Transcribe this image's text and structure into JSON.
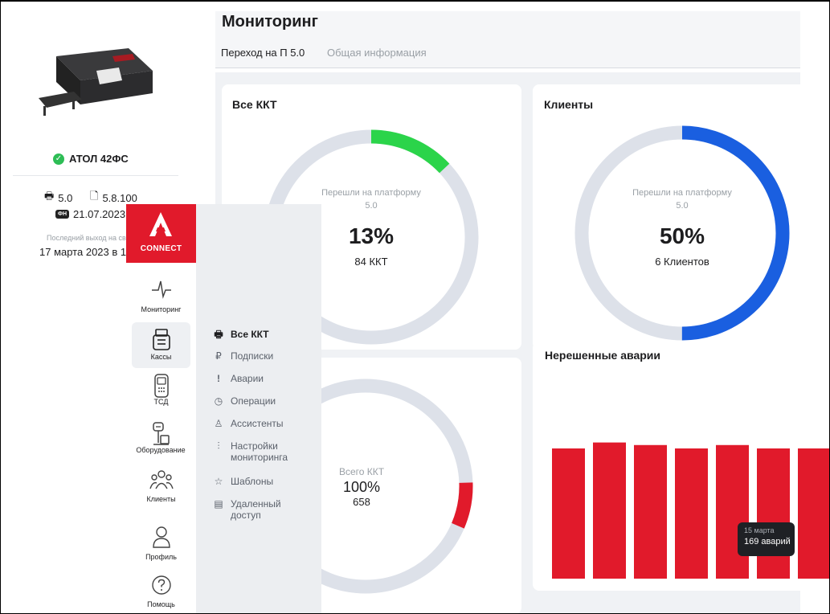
{
  "device": {
    "name": "АТОЛ 42ФС",
    "version_platform": "5.0",
    "version_firmware": "5.8.100",
    "fn_label": "ФН",
    "fn_date": "21.07.2023",
    "last_exit_label": "Последний выход на св",
    "last_exit_date": "17 марта 2023 в 1"
  },
  "header": {
    "title": "Мониторинг",
    "tabs": [
      {
        "label": "Переход на П 5.0",
        "active": true
      },
      {
        "label": "Общая информация",
        "active": false
      }
    ]
  },
  "cards": {
    "all_kkt": {
      "title": "Все ККТ",
      "sub": "Перешли на платформу 5.0",
      "percent": "13%",
      "count": "84 ККТ",
      "color": "#2bd44a"
    },
    "clients": {
      "title": "Клиенты",
      "sub": "Перешли на платформу 5.0",
      "percent": "50%",
      "count": "6 Клиентов",
      "color": "#1a5fe0"
    },
    "total": {
      "label": "Всего ККТ",
      "percent": "100%",
      "count": "658",
      "color": "#e11a2b"
    },
    "alarms": {
      "title": "Нерешенные аварии",
      "tooltip_date": "15 марта",
      "tooltip_value": "169 аварий",
      "color": "#e11a2b"
    }
  },
  "chart_data": [
    {
      "type": "pie",
      "name": "Все ККТ",
      "values": [
        13,
        87
      ]
    },
    {
      "type": "pie",
      "name": "Клиенты",
      "values": [
        50,
        50
      ]
    },
    {
      "type": "pie",
      "name": "Всего ККТ",
      "values": [
        7,
        93
      ]
    },
    {
      "type": "bar",
      "name": "Нерешенные аварии",
      "values": [
        153,
        160,
        157,
        153,
        157,
        153,
        153
      ]
    }
  ],
  "sidebar": {
    "brand": "CONNECT",
    "items": [
      {
        "label": "Мониторинг",
        "icon": "pulse-icon"
      },
      {
        "label": "Кассы",
        "icon": "register-icon"
      },
      {
        "label": "ТСД",
        "icon": "scanner-icon"
      },
      {
        "label": "Оборудование",
        "icon": "equipment-icon"
      },
      {
        "label": "Клиенты",
        "icon": "users-icon"
      },
      {
        "label": "Профиль",
        "icon": "person-icon"
      },
      {
        "label": "Помощь",
        "icon": "help-icon"
      }
    ]
  },
  "submenu": {
    "items": [
      {
        "label": "Все ККТ",
        "icon": "printer-icon",
        "glyph": "🖶"
      },
      {
        "label": "Подписки",
        "icon": "ruble-icon",
        "glyph": "₽"
      },
      {
        "label": "Аварии",
        "icon": "alert-icon",
        "glyph": "!"
      },
      {
        "label": "Операции",
        "icon": "clock-icon",
        "glyph": "◷"
      },
      {
        "label": "Ассистенты",
        "icon": "assistant-icon",
        "glyph": "♙"
      },
      {
        "label": "Настройки мониторинга",
        "icon": "sliders-icon",
        "glyph": "⫶"
      },
      {
        "label": "Шаблоны",
        "icon": "star-icon",
        "glyph": "☆"
      },
      {
        "label": "Удаленный доступ",
        "icon": "document-icon",
        "glyph": "▤"
      }
    ]
  }
}
